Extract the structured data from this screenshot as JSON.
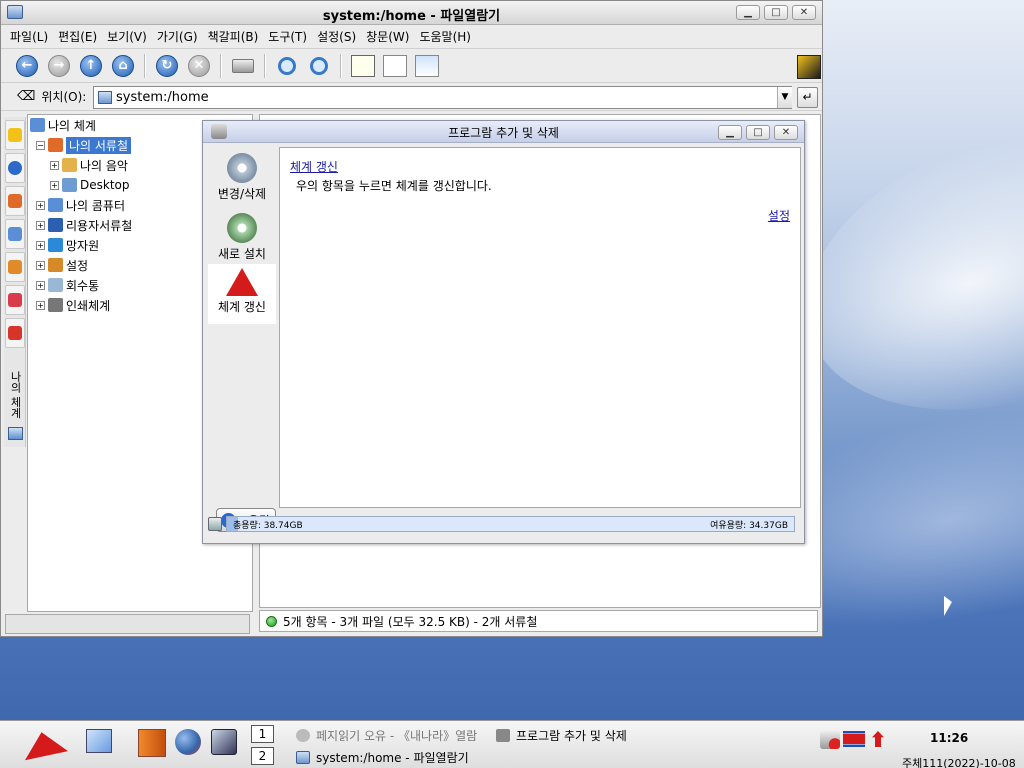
{
  "main_window": {
    "title": "system:/home - 파일열람기",
    "menu": [
      "파일(L)",
      "편집(E)",
      "보기(V)",
      "가기(G)",
      "책갈피(B)",
      "도구(T)",
      "설정(S)",
      "창문(W)",
      "도움말(H)"
    ],
    "location_label": "위치(O):",
    "location_value": "system:/home",
    "sidebar_vertical_label": "나의 체계",
    "tree": [
      {
        "label": "나의 체계",
        "level": 0,
        "expander": "",
        "selected": false,
        "icon": "computer-icon",
        "color": "#5a8fd6"
      },
      {
        "label": "나의 서류철",
        "level": 1,
        "expander": "⊟",
        "selected": true,
        "icon": "folder-icon",
        "color": "#e06a2a"
      },
      {
        "label": "나의 음악",
        "level": 2,
        "expander": "⊕",
        "selected": false,
        "icon": "music-icon",
        "color": "#e3b24a"
      },
      {
        "label": "Desktop",
        "level": 2,
        "expander": "⊕",
        "selected": false,
        "icon": "desktop-icon",
        "color": "#6e9bd1"
      },
      {
        "label": "나의 콤퓨터",
        "level": 1,
        "expander": "⊕",
        "selected": false,
        "icon": "computer-icon",
        "color": "#5a8fd6"
      },
      {
        "label": "리용자서류철",
        "level": 1,
        "expander": "⊕",
        "selected": false,
        "icon": "user-folder-icon",
        "color": "#2d5fb0"
      },
      {
        "label": "망자원",
        "level": 1,
        "expander": "⊕",
        "selected": false,
        "icon": "network-icon",
        "color": "#2a8ad8"
      },
      {
        "label": "설정",
        "level": 1,
        "expander": "⊕",
        "selected": false,
        "icon": "settings-icon",
        "color": "#d58a2a"
      },
      {
        "label": "회수통",
        "level": 1,
        "expander": "⊕",
        "selected": false,
        "icon": "trash-icon",
        "color": "#9ab7d6"
      },
      {
        "label": "인쇄체계",
        "level": 1,
        "expander": "⊕",
        "selected": false,
        "icon": "printer-icon",
        "color": "#777777"
      }
    ],
    "status": "5개 항목 - 3개 파일 (모두 32.5 KB) - 2개 서류철"
  },
  "dialog": {
    "title": "프로그람 추가 및 삭제",
    "sidebar": [
      {
        "label": "변경/삭제",
        "active": false,
        "icon": "cd-computer-icon"
      },
      {
        "label": "새로 설치",
        "active": false,
        "icon": "cd-install-icon"
      },
      {
        "label": "체계 갱신",
        "active": true,
        "icon": "red-star-icon"
      }
    ],
    "heading_link": "체계 갱신",
    "description": "우의 항목을 누르면 체계를 갱신합니다.",
    "settings_link": "설정",
    "help_button": "도움말",
    "total_capacity": "총용량: 38.74GB",
    "free_capacity": "여유용량: 34.37GB",
    "used_fraction": 0.02
  },
  "taskbar": {
    "pagers": [
      "1",
      "2"
    ],
    "tasks": [
      {
        "label": "페지읽기 오유 - 《내나라》열람",
        "icon": "browser-icon",
        "dimmed": true
      },
      {
        "label": "프로그람 추가 및 삭제",
        "icon": "installer-icon",
        "dimmed": false
      },
      {
        "label": "system:/home - 파일열람기",
        "icon": "file-manager-icon",
        "dimmed": false
      }
    ],
    "clock": "11:26",
    "date": "주체111(2022)-10-08"
  },
  "colors": {
    "accent": "#3b78d0",
    "selection": "#3b78d0",
    "link": "#1a1aa6",
    "status_led": "#1f9a1f"
  }
}
